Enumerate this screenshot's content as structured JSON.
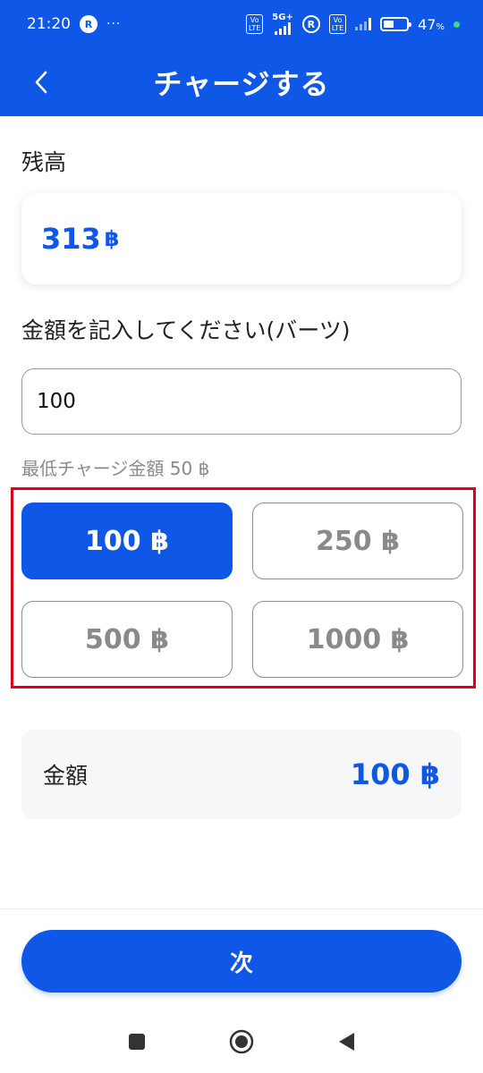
{
  "status_bar": {
    "time": "21:20",
    "badge": "R",
    "dots": "···",
    "volte1": "Vo\nLTE",
    "network": "5G+",
    "roaming": "R",
    "volte2": "Vo\nLTE",
    "battery_percent": "47",
    "battery_unit": "%",
    "battery_level": 0.47
  },
  "header": {
    "title": "チャージする",
    "back_icon": "chevron-left-icon"
  },
  "balance": {
    "label": "残高",
    "value": "313",
    "unit": "฿"
  },
  "amount": {
    "label": "金額を記入してください(バーツ)",
    "value": "100",
    "min_note": "最低チャージ金額 50 ฿"
  },
  "presets": [
    {
      "label": "100 ฿",
      "selected": true
    },
    {
      "label": "250 ฿",
      "selected": false
    },
    {
      "label": "500 ฿",
      "selected": false
    },
    {
      "label": "1000 ฿",
      "selected": false
    }
  ],
  "total": {
    "label": "金額",
    "value": "100 ฿"
  },
  "next_button": "次",
  "colors": {
    "primary": "#0f57e6",
    "highlight_frame": "#e0001b"
  },
  "nav_icons": [
    "square-icon",
    "circle-home-icon",
    "triangle-back-icon"
  ]
}
